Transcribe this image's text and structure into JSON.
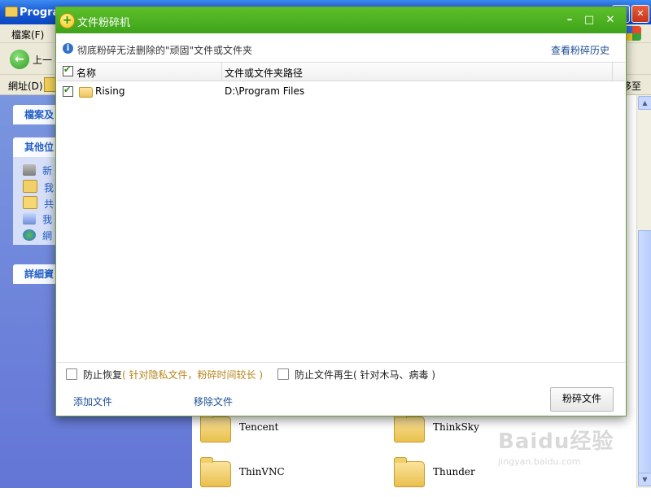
{
  "explorer": {
    "title": "Program",
    "menu_file": "檔案(F)",
    "back_label": "上一",
    "address_label": "網址(D)",
    "go_partial": "移至",
    "panels": {
      "file_tasks": "檔案及",
      "other_places": "其他位",
      "details": "詳細資"
    },
    "other_places_links": [
      "新",
      "我",
      "共",
      "我",
      "網"
    ],
    "folders": [
      "Tencent",
      "ThinkSky",
      "ThinVNC",
      "Thunder"
    ]
  },
  "watermark": {
    "brand": "Baidu经验",
    "url": "jingyan.baidu.com"
  },
  "dialog": {
    "title": "文件粉碎机",
    "info": "彻底粉碎无法删除的\"顽固\"文件或文件夹",
    "history_link": "查看粉碎历史",
    "columns": {
      "name": "名称",
      "path": "文件或文件夹路径"
    },
    "rows": [
      {
        "name": "Rising",
        "path": "D:\\Program Files",
        "checked": true
      }
    ],
    "options": {
      "prevent_recovery": "防止恢复",
      "prevent_recovery_note": "( 针对隐私文件，粉碎时间较长 )",
      "prevent_regen": "防止文件再生",
      "prevent_regen_note": "( 针对木马、病毒 )"
    },
    "footer": {
      "add": "添加文件",
      "remove": "移除文件",
      "shred": "粉碎文件"
    }
  },
  "colors": {
    "dialog_titlebar": "#4cb323",
    "link_blue": "#1d4f93",
    "warning_text": "#b7841b",
    "xp_blue": "#1d5fd6"
  }
}
